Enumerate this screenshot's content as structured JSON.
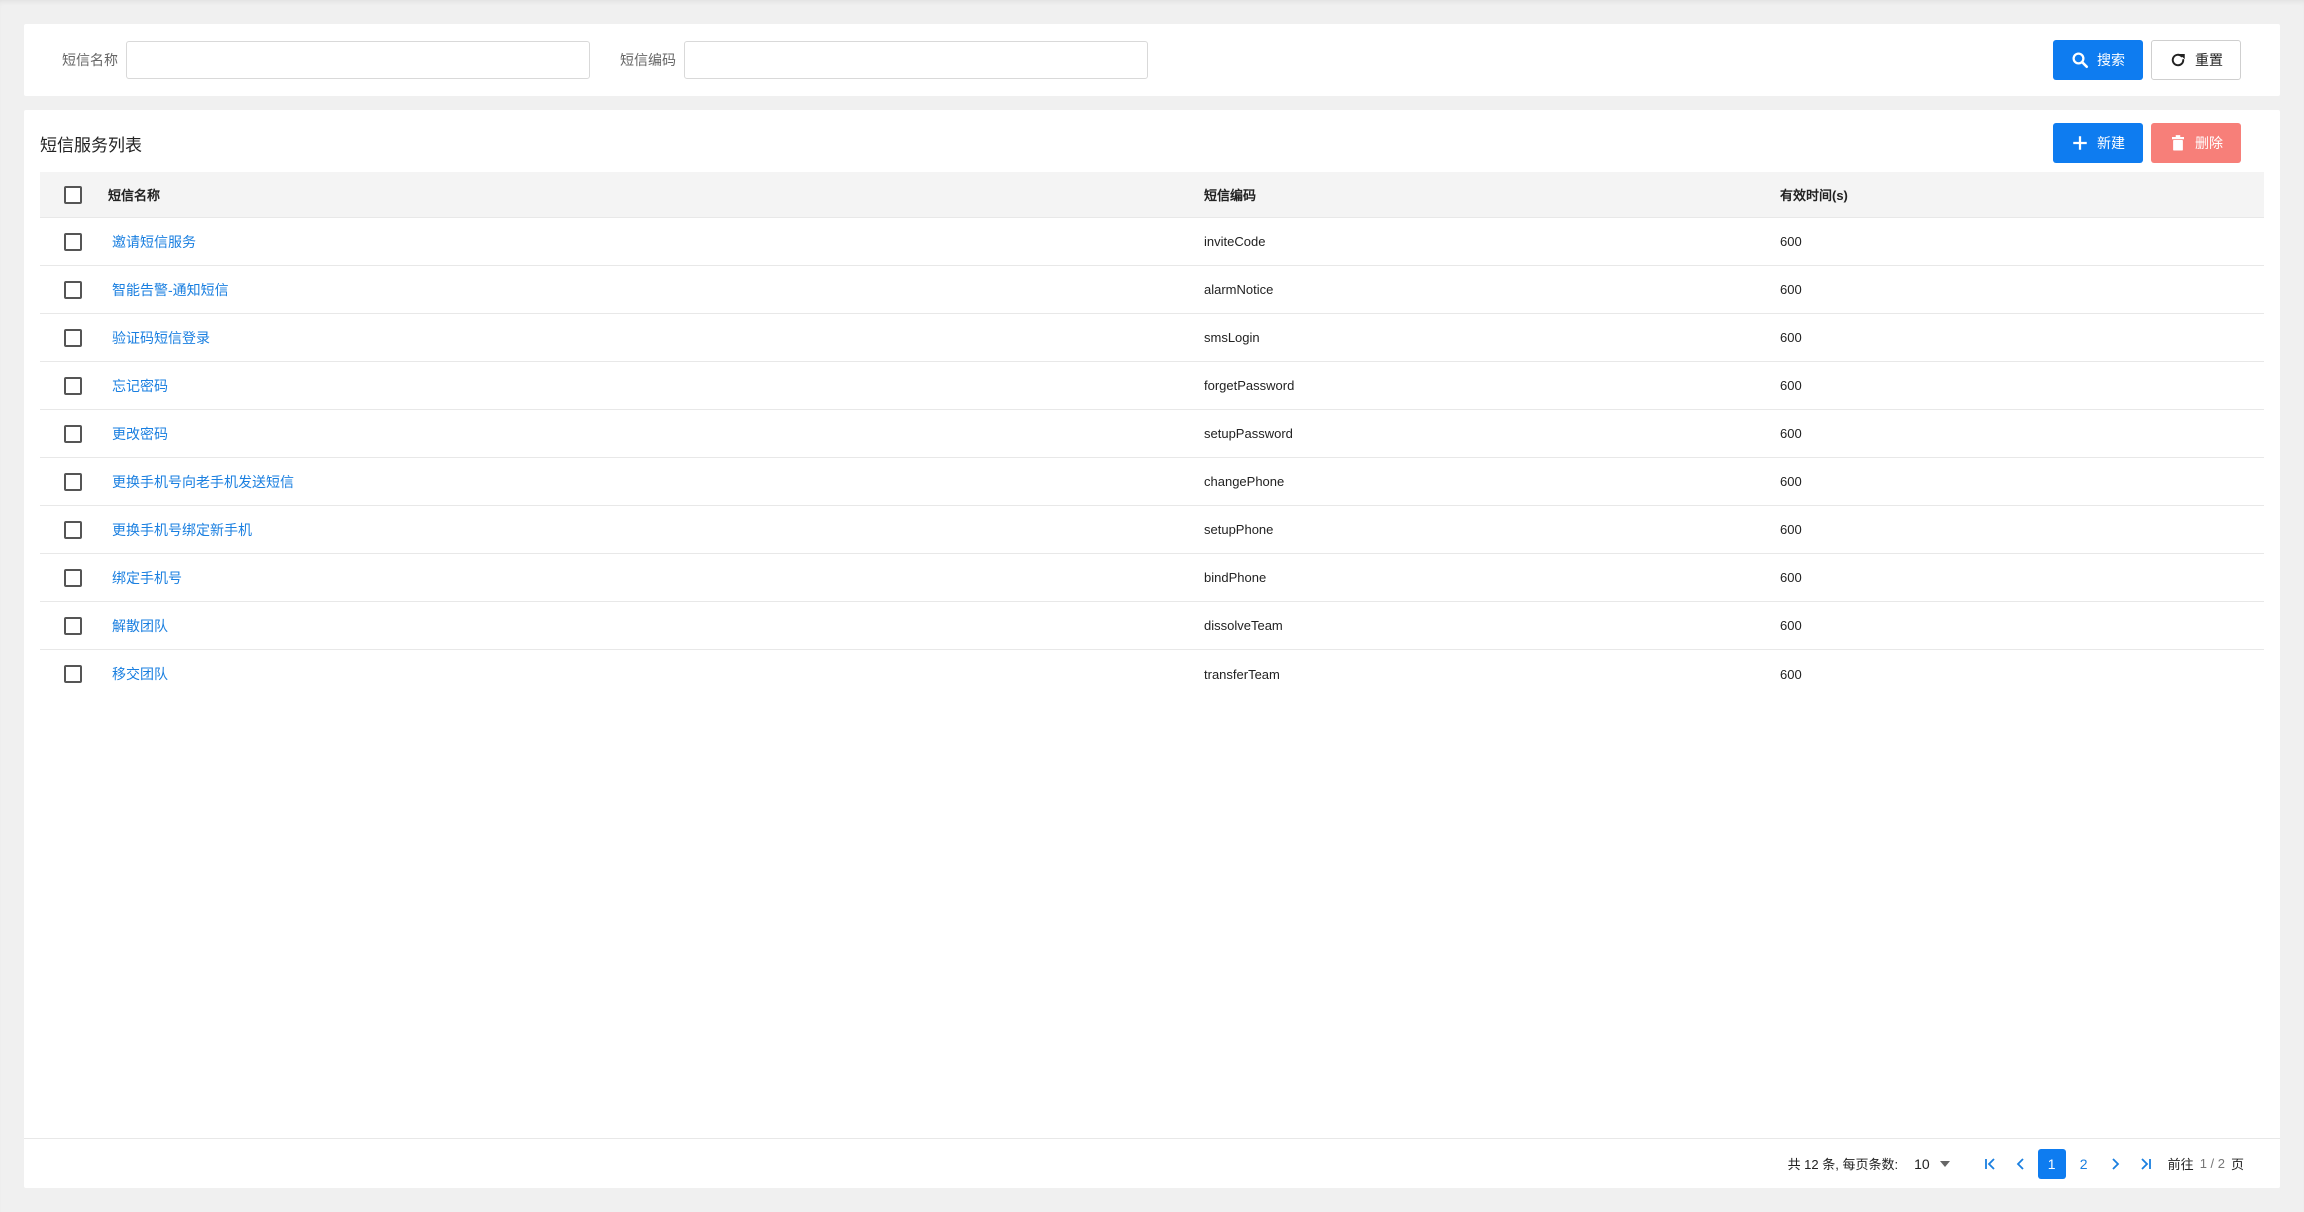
{
  "search": {
    "name_label": "短信名称",
    "name_value": "",
    "code_label": "短信编码",
    "code_value": "",
    "search_button": "搜索",
    "reset_button": "重置"
  },
  "list": {
    "title": "短信服务列表",
    "new_button": "新建",
    "delete_button": "删除",
    "columns": [
      "短信名称",
      "短信编码",
      "有效时间(s)"
    ],
    "rows": [
      {
        "name": "邀请短信服务",
        "code": "inviteCode",
        "time": "600"
      },
      {
        "name": "智能告警-通知短信",
        "code": "alarmNotice",
        "time": "600"
      },
      {
        "name": "验证码短信登录",
        "code": "smsLogin",
        "time": "600"
      },
      {
        "name": "忘记密码",
        "code": "forgetPassword",
        "time": "600"
      },
      {
        "name": "更改密码",
        "code": "setupPassword",
        "time": "600"
      },
      {
        "name": "更换手机号向老手机发送短信",
        "code": "changePhone",
        "time": "600"
      },
      {
        "name": "更换手机号绑定新手机",
        "code": "setupPhone",
        "time": "600"
      },
      {
        "name": "绑定手机号",
        "code": "bindPhone",
        "time": "600"
      },
      {
        "name": "解散团队",
        "code": "dissolveTeam",
        "time": "600"
      },
      {
        "name": "移交团队",
        "code": "transferTeam",
        "time": "600"
      }
    ]
  },
  "pagination": {
    "total_text": "共 12 条, 每页条数:",
    "page_size": "10",
    "pages": [
      "1",
      "2"
    ],
    "current_page": "1",
    "goto_label": "前往",
    "goto_value": "1 / 2",
    "page_suffix": "页"
  },
  "colors": {
    "primary": "#0e7cf0",
    "danger": "#f77f79",
    "link": "#1a7fe0"
  }
}
